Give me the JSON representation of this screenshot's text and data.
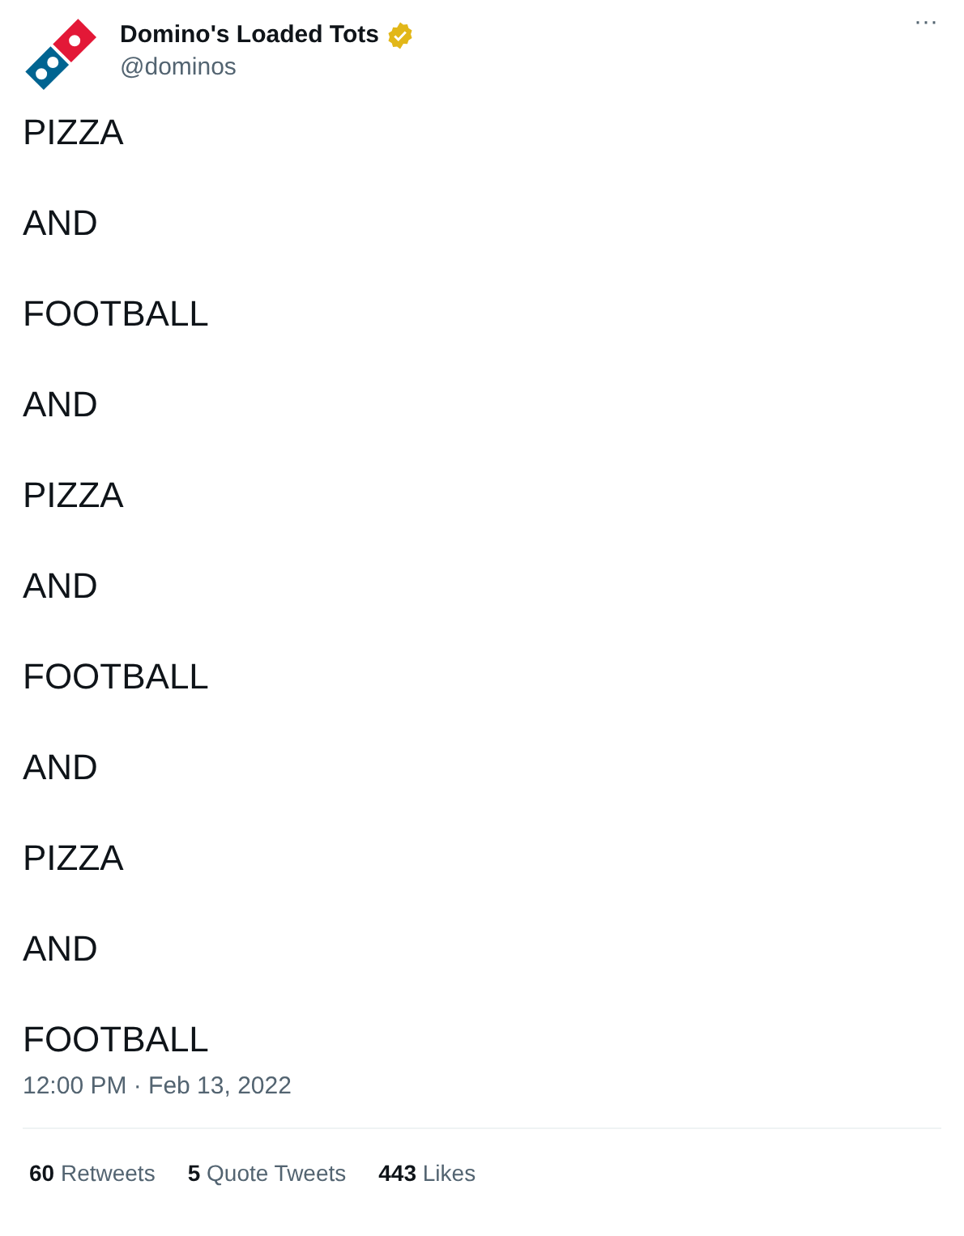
{
  "author": {
    "name": "Domino's Loaded Tots",
    "handle": "@dominos",
    "verified": true
  },
  "more_button": "···",
  "body_lines": [
    "PIZZA",
    "AND",
    "FOOTBALL",
    "AND",
    "PIZZA",
    "AND",
    "FOOTBALL",
    "AND",
    "PIZZA",
    "AND",
    "FOOTBALL"
  ],
  "timestamp": "12:00 PM · Feb 13, 2022",
  "stats": [
    {
      "count": "60",
      "label": "Retweets"
    },
    {
      "count": "5",
      "label": "Quote Tweets"
    },
    {
      "count": "443",
      "label": "Likes"
    }
  ]
}
